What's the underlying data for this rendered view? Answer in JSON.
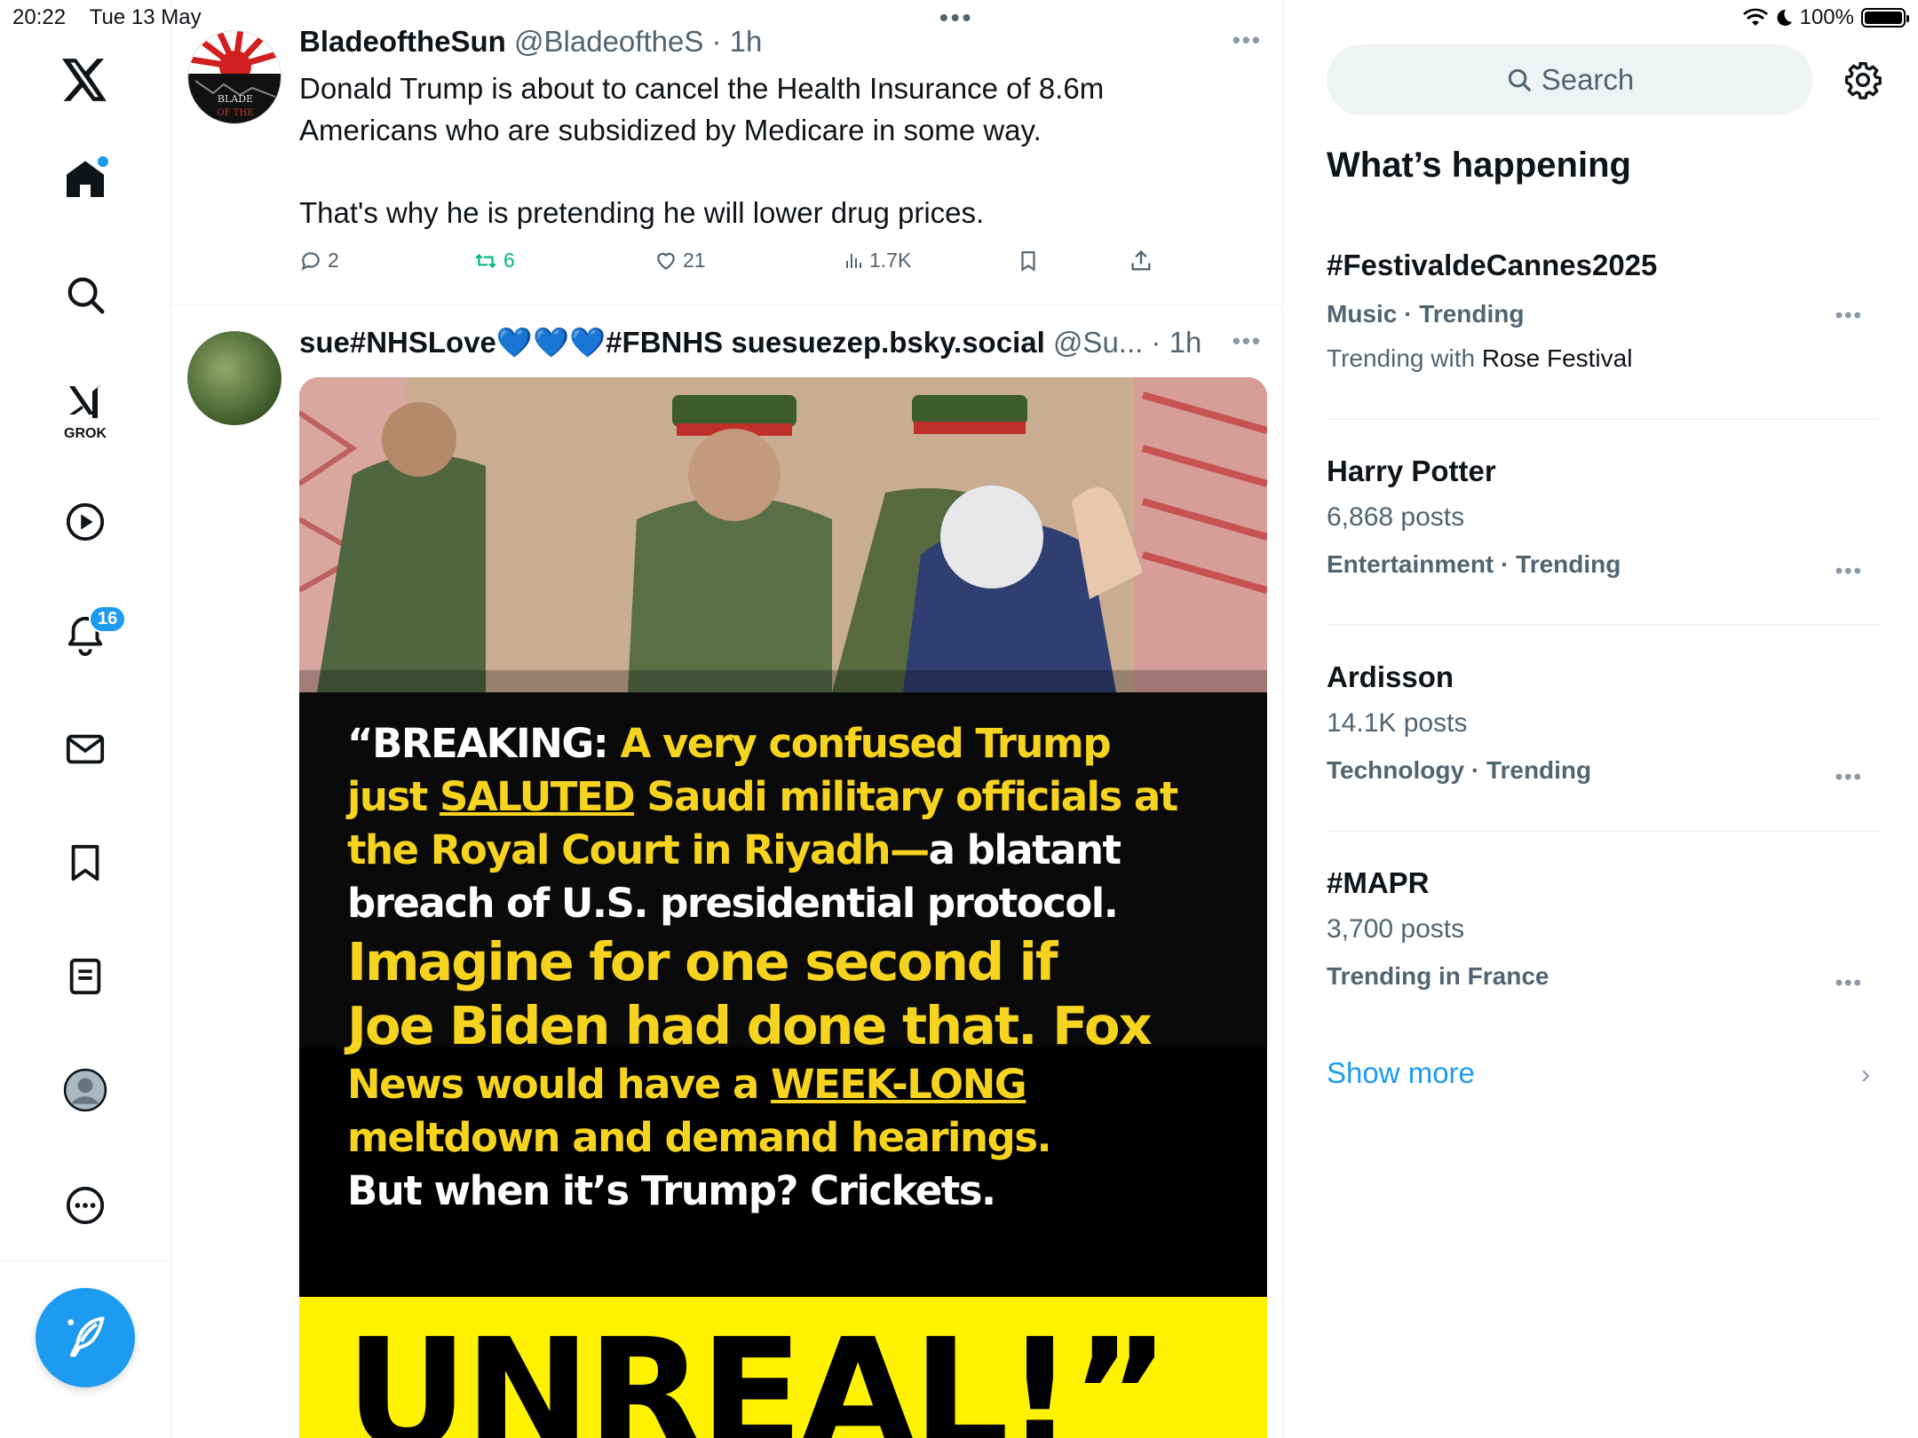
{
  "status": {
    "time": "20:22",
    "date": "Tue 13 May",
    "battery": "100%"
  },
  "nav": {
    "notif_badge": "16",
    "grok_label": "GROK"
  },
  "tweet1": {
    "name": "BladeoftheSun",
    "handle_time": "@BladeoftheS · 1h",
    "avatar_text": "BLADE OF THE",
    "text_p1": "Donald Trump is about to cancel the Health Insurance of 8.6m Americans who are subsidized by Medicare in some way.",
    "text_p2": "That's why he is pretending he will lower drug prices.",
    "replies": "2",
    "reposts": "6",
    "likes": "21",
    "views": "1.7K"
  },
  "tweet2": {
    "name": "sue#NHSLove💙💙💙#FBNHS suesuezep.bsky.social",
    "handle_time": "@Su... · 1h",
    "image_lines": [
      "“BREAKING:",
      "A very confused Trump",
      "just",
      "SALUTED",
      "Saudi military officials at",
      "the Royal Court in Riyadh—",
      "a blatant",
      "breach of U.S. presidential protocol.",
      "Imagine for one second if",
      "Joe Biden had done that. Fox",
      "News would have a",
      "WEEK-LONG",
      "meltdown and demand hearings.",
      "But when it’s Trump? Crickets.",
      "UNREAL!”"
    ]
  },
  "sidebar": {
    "search_placeholder": "Search",
    "heading": "What’s happening",
    "trends": [
      {
        "title": "#FestivaldeCannes2025",
        "context": "Music · Trending",
        "with_prefix": "Trending with",
        "with_value": "Rose Festival"
      },
      {
        "title": "Harry Potter",
        "posts": "6,868 posts",
        "context": "Entertainment · Trending"
      },
      {
        "title": "Ardisson",
        "posts": "14.1K posts",
        "context": "Technology · Trending"
      },
      {
        "title": "#MAPR",
        "posts": "3,700 posts",
        "context": "Trending in France"
      }
    ],
    "show_more": "Show more"
  },
  "colors": {
    "accent": "#1d9bf0",
    "repost": "#00ba7c",
    "muted": "#536471",
    "poster_yellow": "#f6d31e"
  },
  "icons": [
    "x-logo-icon",
    "home-icon",
    "search-icon",
    "grok-icon",
    "video-icon",
    "bell-icon",
    "mail-icon",
    "bookmark-icon",
    "list-icon",
    "profile-icon",
    "more-icon",
    "compose-icon",
    "reply-icon",
    "repost-icon",
    "like-icon",
    "views-icon",
    "share-icon",
    "gear-icon",
    "chevron-right-icon"
  ]
}
